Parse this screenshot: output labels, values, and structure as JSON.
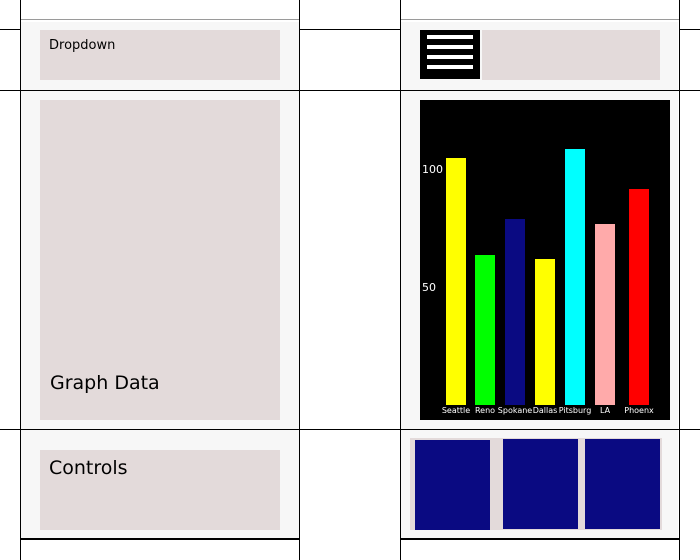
{
  "panels": {
    "dropdown_label": "Dropdown",
    "graph_label": "Graph Data",
    "controls_label": "Controls"
  },
  "menu_icon": "hamburger-menu-icon",
  "controls": [
    "control-block-1",
    "control-block-2",
    "control-block-3"
  ],
  "chart_data": {
    "type": "bar",
    "categories": [
      "Seattle",
      "Reno",
      "Spokane",
      "Dallas",
      "Pitsburg",
      "LA",
      "Phoenx"
    ],
    "values": [
      105,
      64,
      79,
      62,
      109,
      77,
      92
    ],
    "colors": [
      "#ffff00",
      "#00ff00",
      "#0a0a82",
      "#ffff00",
      "#00ffff",
      "#ffaaaa",
      "#ff0000"
    ],
    "yticks": [
      50,
      100
    ],
    "ylim": [
      0,
      109
    ],
    "background": "#000000",
    "grid": false,
    "title": "",
    "xlabel": "",
    "ylabel": ""
  }
}
